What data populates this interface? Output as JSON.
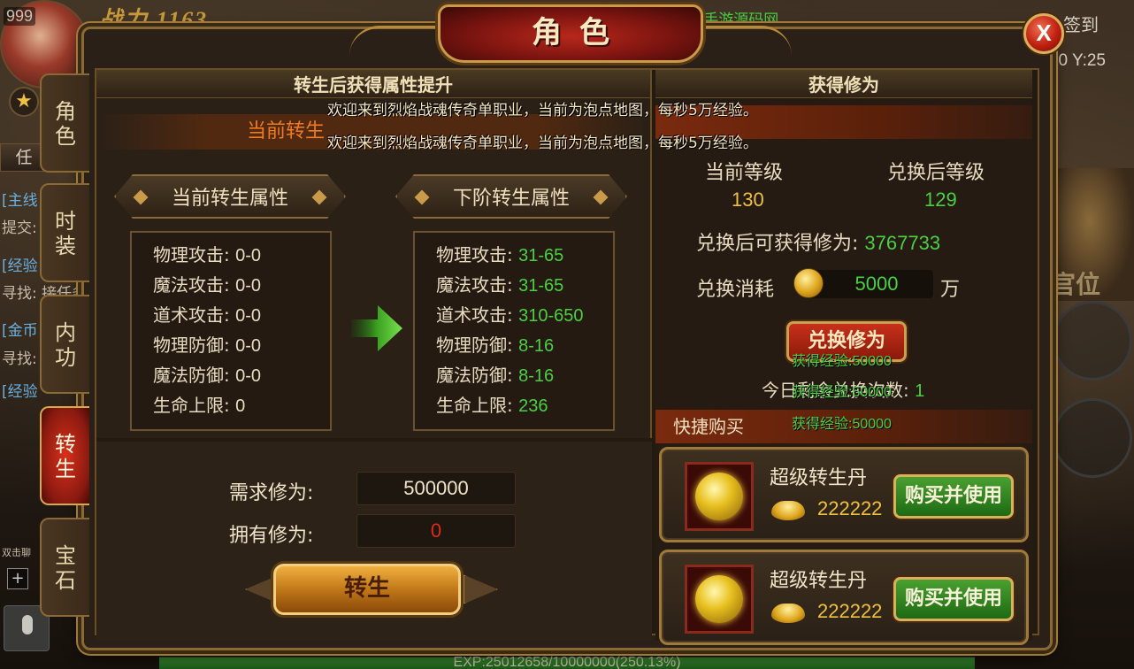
{
  "background": {
    "level": "999",
    "power": "战力 1163",
    "quest_text": "打我必得人民币 · 手游源码网",
    "checkin": "签到",
    "coord": "0 Y:25",
    "left_texts": [
      "[主线",
      "提交:",
      "[经验",
      "寻找: 接任务",
      "[金币",
      "寻找:",
      "[经验"
    ],
    "chat_hint": "双击聊",
    "task_button": "任",
    "guanwei": "官位",
    "exp_text": "EXP:25012658/10000000(250.13%)",
    "exp_percent": 100
  },
  "window": {
    "title": "角色",
    "close_label": "X"
  },
  "tabs": [
    {
      "label": "角色",
      "active": false
    },
    {
      "label": "时装",
      "active": false
    },
    {
      "label": "内功",
      "active": false
    },
    {
      "label": "转生",
      "active": true
    },
    {
      "label": "宝石",
      "active": false
    }
  ],
  "left_panel": {
    "header": "转生后获得属性提升",
    "subtitle": "当前转生",
    "current_title": "当前转生属性",
    "next_title": "下阶转生属性",
    "current_attrs": [
      {
        "label": "物理攻击:",
        "value": "0-0"
      },
      {
        "label": "魔法攻击:",
        "value": "0-0"
      },
      {
        "label": "道术攻击:",
        "value": "0-0"
      },
      {
        "label": "物理防御:",
        "value": "0-0"
      },
      {
        "label": "魔法防御:",
        "value": "0-0"
      },
      {
        "label": "生命上限:",
        "value": "0"
      }
    ],
    "next_attrs": [
      {
        "label": "物理攻击:",
        "value": "31-65"
      },
      {
        "label": "魔法攻击:",
        "value": "31-65"
      },
      {
        "label": "道术攻击:",
        "value": "310-650"
      },
      {
        "label": "物理防御:",
        "value": "8-16"
      },
      {
        "label": "魔法防御:",
        "value": "8-16"
      },
      {
        "label": "生命上限:",
        "value": "236"
      }
    ],
    "need_label": "需求修为:",
    "need_value": "500000",
    "own_label": "拥有修为:",
    "own_value": "0",
    "rebirth_button": "转生"
  },
  "right_panel": {
    "header": "获得修为",
    "current_level_label": "当前等级",
    "current_level": "130",
    "after_level_label": "兑换后等级",
    "after_level": "129",
    "gain_label": "兑换后可获得修为:",
    "gain_value": "3767733",
    "cost_label": "兑换消耗",
    "cost_value": "5000",
    "cost_unit": "万",
    "exchange_button": "兑换修为",
    "remain_label": "今日剩余兑换次数:",
    "remain_value": "1",
    "quick_buy": "快捷购买",
    "shop_items": [
      {
        "name": "超级转生丹",
        "price": "222222",
        "button": "购买并使用"
      },
      {
        "name": "超级转生丹",
        "price": "222222",
        "button": "购买并使用"
      }
    ]
  },
  "system_messages": [
    "欢迎来到烈焰战魂传奇单职业，当前为泡点地图，每秒5万经验。",
    "欢迎来到烈焰战魂传奇单职业，当前为泡点地图，每秒5万经验。"
  ],
  "floating_gains": [
    "获得经验:50000",
    "获得经验:50000",
    "获得经验:50000"
  ]
}
